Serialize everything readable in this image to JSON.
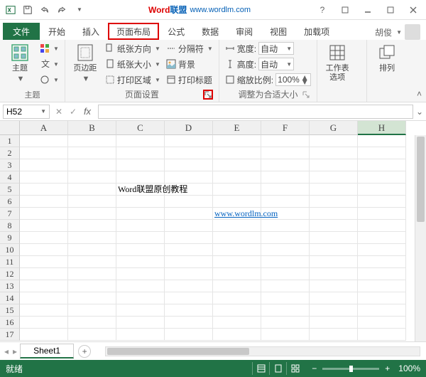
{
  "titlebar": {
    "brand_word": "Word",
    "brand_rest": "联盟",
    "subtitle": "www.wordlm.com"
  },
  "tabs": {
    "file": "文件",
    "home": "开始",
    "insert": "插入",
    "page_layout": "页面布局",
    "formulas": "公式",
    "data": "数据",
    "review": "审阅",
    "view": "视图",
    "addins": "加载项"
  },
  "user": {
    "name": "胡俊"
  },
  "ribbon": {
    "themes": {
      "label": "主题",
      "btn": "主题"
    },
    "page_setup": {
      "label": "页面设置",
      "margins": "页边距",
      "orientation": "纸张方向",
      "size": "纸张大小",
      "print_area": "打印区域",
      "breaks": "分隔符",
      "background": "背景",
      "print_titles": "打印标题"
    },
    "scale_to_fit": {
      "label": "调整为合适大小",
      "width": "宽度:",
      "height": "高度:",
      "scale": "缩放比例:",
      "auto": "自动",
      "scale_val": "100%"
    },
    "sheet_options": {
      "worksheet_options": "工作表选项"
    },
    "arrange": {
      "arrange": "排列"
    }
  },
  "formula_bar": {
    "cell_ref": "H52"
  },
  "columns": [
    "A",
    "B",
    "C",
    "D",
    "E",
    "F",
    "G",
    "H"
  ],
  "row_count": 17,
  "cells": {
    "C5": "Word联盟原创教程",
    "E7": "www.wordlm.com"
  },
  "sheets": {
    "sheet1": "Sheet1"
  },
  "statusbar": {
    "ready": "就绪",
    "zoom": "100%"
  }
}
